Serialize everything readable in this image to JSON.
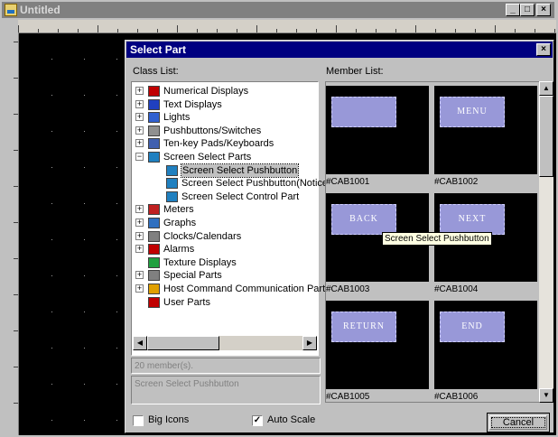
{
  "window": {
    "title": "Untitled",
    "min": "_",
    "max": "□",
    "close": "×"
  },
  "dialog": {
    "title": "Select Part",
    "close": "×",
    "class_list_label": "Class List:",
    "member_list_label": "Member List:",
    "tree": [
      {
        "label": "Numerical Displays",
        "icon": "numerical-display-icon",
        "color": "#c00000",
        "expand": "+"
      },
      {
        "label": "Text Displays",
        "icon": "text-display-icon",
        "color": "#2040c0",
        "expand": "+"
      },
      {
        "label": "Lights",
        "icon": "lights-icon",
        "color": "#3060d0",
        "expand": "+"
      },
      {
        "label": "Pushbuttons/Switches",
        "icon": "pushbutton-icon",
        "color": "#909090",
        "expand": "+"
      },
      {
        "label": "Ten-key Pads/Keyboards",
        "icon": "keypad-icon",
        "color": "#4060b0",
        "expand": "+"
      },
      {
        "label": "Screen Select Parts",
        "icon": "screen-select-icon",
        "color": "#2080c0",
        "expand": "−"
      },
      {
        "label": "Screen Select Pushbutton",
        "icon": "screen-select-icon",
        "color": "#2080c0",
        "expand": "",
        "child": true,
        "selected": true
      },
      {
        "label": "Screen Select Pushbutton(Notice",
        "icon": "screen-select-icon",
        "color": "#2080c0",
        "expand": "",
        "child": true
      },
      {
        "label": "Screen Select Control Part",
        "icon": "screen-select-icon",
        "color": "#2080c0",
        "expand": "",
        "child": true
      },
      {
        "label": "Meters",
        "icon": "meter-icon",
        "color": "#c02020",
        "expand": "+"
      },
      {
        "label": "Graphs",
        "icon": "graph-icon",
        "color": "#3070c0",
        "expand": "+"
      },
      {
        "label": "Clocks/Calendars",
        "icon": "clock-icon",
        "color": "#808080",
        "expand": "+"
      },
      {
        "label": "Alarms",
        "icon": "alarm-icon",
        "color": "#c00000",
        "expand": "+"
      },
      {
        "label": "Texture Displays",
        "icon": "texture-icon",
        "color": "#20a040",
        "expand": ""
      },
      {
        "label": "Special Parts",
        "icon": "special-parts-icon",
        "color": "#808080",
        "expand": "+"
      },
      {
        "label": "Host Command Communication Parts",
        "icon": "host-command-icon",
        "color": "#e0a000",
        "expand": "+"
      },
      {
        "label": "User Parts",
        "icon": "user-parts-icon",
        "color": "#c00000",
        "expand": ""
      }
    ],
    "member_count": "20 member(s).",
    "selected_class": "Screen Select Pushbutton",
    "members": [
      {
        "id": "#CAB1001",
        "text": ""
      },
      {
        "id": "#CAB1002",
        "text": "MENU"
      },
      {
        "id": "#CAB1003",
        "text": "BACK"
      },
      {
        "id": "#CAB1004",
        "text": "NEXT"
      },
      {
        "id": "#CAB1005",
        "text": "RETURN"
      },
      {
        "id": "#CAB1006",
        "text": "END"
      }
    ],
    "tooltip": "Screen Select Pushbutton",
    "big_icons": {
      "label": "Big Icons",
      "checked": false
    },
    "auto_scale": {
      "label": "Auto Scale",
      "checked": true
    },
    "cancel": "Cancel"
  }
}
